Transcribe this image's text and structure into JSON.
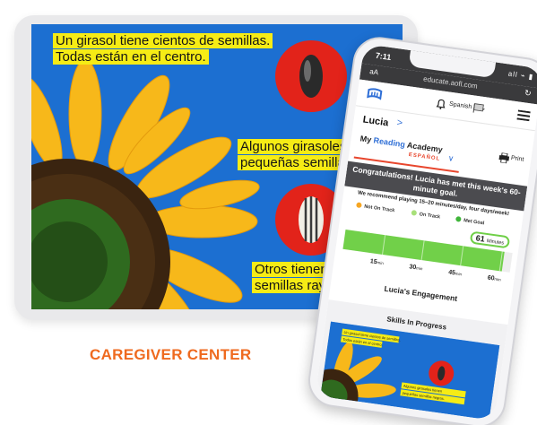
{
  "tablet": {
    "captions": [
      "Un girasol tiene cientos de semillas.",
      "Todas están en el centro.",
      "Algunos girasoles ti",
      "pequeñas semillas.",
      "Otros tienen",
      "semillas rayad"
    ]
  },
  "phone": {
    "status": {
      "time": "7:11",
      "icons": "all ⌁ ▮"
    },
    "browser": {
      "text_size": "aA",
      "url": "educate.aofl.com",
      "reload_icon": "reload-icon"
    },
    "header": {
      "language": "Spanish",
      "logo_icon": "app-logo-icon",
      "bell_icon": "bell-icon",
      "flag_icon": "flag-icon",
      "menu_icon": "hamburger-menu-icon"
    },
    "child": {
      "name": "Lucia",
      "chevron": ">"
    },
    "academy": {
      "prefix": "My ",
      "reading": "Reading",
      "suffix": " Academy",
      "language_tag": "ESPAÑOL",
      "chevron": "∨"
    },
    "print_label": "Print",
    "congrats": "Congratulations! Lucia has met this week's 60-minute goal.",
    "recommendation": "We recommend playing 15–20 minutes/day, four days/week!",
    "legend": [
      {
        "label": "Not On Track",
        "color": "#f6a623"
      },
      {
        "label": "On Track",
        "color": "#a8e07a"
      },
      {
        "label": "Met Goal",
        "color": "#3fb53a"
      }
    ],
    "progress": {
      "minutes": 61,
      "minutes_value": "61",
      "unit_label": "Minutes",
      "goal": 60,
      "scale_max": 64,
      "ticks": [
        {
          "value": "15",
          "unit": "min"
        },
        {
          "value": "30",
          "unit": "min"
        },
        {
          "value": "45",
          "unit": "min"
        },
        {
          "value": "60",
          "unit": "min"
        }
      ]
    },
    "engagement_title": "Lucia's Engagement",
    "skills_title": "Skills In Progress",
    "skills_thumb_captions": [
      "Un girasol tiene cientos de semillas.",
      "Todas están en el centro.",
      "Algunos girasoles tienen",
      "pequeñas semillas negras."
    ]
  },
  "caregiver_center_title": "CAREGIVER CENTER",
  "colors": {
    "sky": "#1c6fd1",
    "petal": "#f7b81a",
    "highlight": "#f6ec15",
    "seed_circle": "#e2231a",
    "progress_green": "#71d049",
    "brand_orange": "#ef6a1f"
  }
}
